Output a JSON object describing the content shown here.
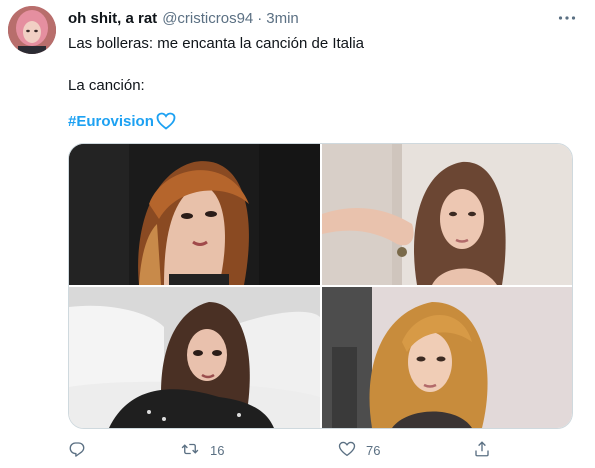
{
  "tweet": {
    "author_name": "oh shit, a rat",
    "handle": "@cristicros94",
    "separator": "·",
    "time": "3min",
    "text_line1": "Las bolleras: me encanta la canción de Italia",
    "text_line2": "La canción:",
    "hashtag": "#Eurovision",
    "hashtag_emoji": "blue-heart-icon"
  },
  "media": {
    "photos": [
      "photo-1",
      "photo-2",
      "photo-3",
      "photo-4"
    ]
  },
  "actions": {
    "reply_count": "",
    "retweet_count": "16",
    "like_count": "76"
  },
  "colors": {
    "text": "#0f1419",
    "muted": "#5b7083",
    "link": "#1da1f2",
    "border": "#cfd9de"
  }
}
